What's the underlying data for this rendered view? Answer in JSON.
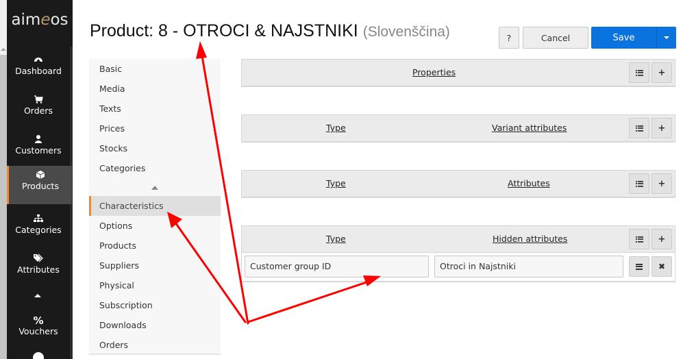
{
  "app": {
    "logo_text_pre": "aim",
    "logo_text_accent": "e",
    "logo_text_post": "os"
  },
  "nav": {
    "items": [
      {
        "label": "Dashboard",
        "icon": "dashboard-icon"
      },
      {
        "label": "Orders",
        "icon": "cart-icon"
      },
      {
        "label": "Customers",
        "icon": "user-icon"
      },
      {
        "label": "Products",
        "icon": "cube-icon",
        "active": true
      },
      {
        "label": "Categories",
        "icon": "sitemap-icon"
      },
      {
        "label": "Attributes",
        "icon": "tags-icon"
      },
      {
        "label": "Vouchers",
        "icon": "percent-icon"
      }
    ],
    "collapse_icon": "caret-up-icon"
  },
  "header": {
    "title": "Product: 8 - OTROCI & NAJSTNIKI",
    "language": "(Slovenščina)",
    "help_label": "?",
    "cancel_label": "Cancel",
    "save_label": "Save"
  },
  "tabs": {
    "items_top": [
      "Basic",
      "Media",
      "Texts",
      "Prices",
      "Stocks",
      "Categories"
    ],
    "items_bottom": [
      "Characteristics",
      "Options",
      "Products",
      "Suppliers",
      "Physical",
      "Subscription",
      "Downloads",
      "Orders"
    ],
    "active": "Characteristics"
  },
  "panels": {
    "properties": {
      "heading": "Properties"
    },
    "variant": {
      "type_label": "Type",
      "heading": "Variant attributes"
    },
    "attributes": {
      "type_label": "Type",
      "heading": "Attributes"
    },
    "hidden": {
      "type_label": "Type",
      "heading": "Hidden attributes",
      "rows": [
        {
          "type": "Customer group ID",
          "value": "Otroci in Najstniki"
        }
      ]
    }
  },
  "colors": {
    "accent": "#f0892a",
    "primary": "#0b73dd",
    "annotation": "#ff0000"
  }
}
